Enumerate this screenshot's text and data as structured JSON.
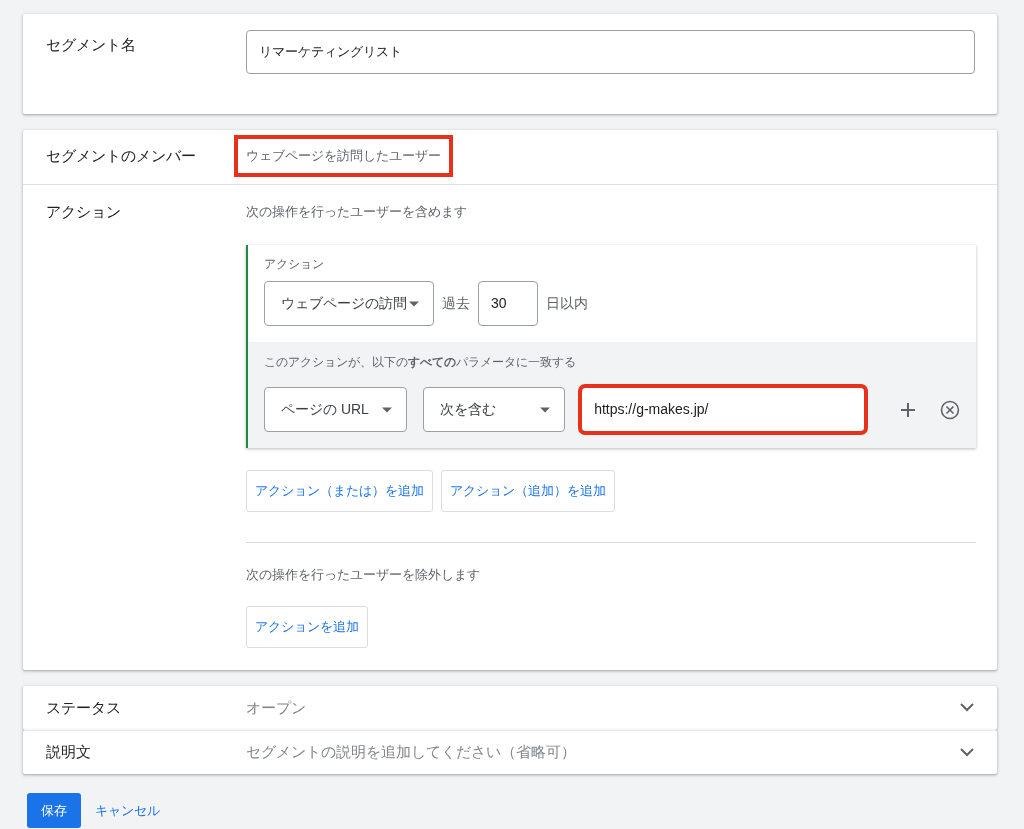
{
  "segment_name": {
    "label": "セグメント名",
    "value": "リマーケティングリスト"
  },
  "members": {
    "label": "セグメントのメンバー",
    "value": "ウェブページを訪問したユーザー",
    "highlighted": true
  },
  "actions": {
    "label": "アクション",
    "include_text": "次の操作を行ったユーザーを含めます",
    "action_card": {
      "title": "アクション",
      "action_type": "ウェブページの訪問",
      "period_prefix": "過去",
      "days": "30",
      "period_suffix": "日以内",
      "match_text": "このアクションが、以下の**すべての**パラメータに一致する",
      "rule": {
        "parameter": "ページの URL",
        "operator": "次を含む",
        "value": "https://g-makes.jp/",
        "highlighted": true
      }
    },
    "add_buttons": [
      "アクション（または）を追加",
      "アクション（追加）を追加"
    ],
    "exclude_text": "次の操作を行ったユーザーを除外します",
    "exclude_button": "アクションを追加"
  },
  "collapsed_rows": [
    {
      "label": "ステータス",
      "value": "オープン",
      "expanded": false
    },
    {
      "label": "説明文",
      "value": "セグメントの説明を追加してください（省略可）",
      "expanded": false
    }
  ],
  "buttons": {
    "save": "保存",
    "cancel": "キャンセル"
  }
}
